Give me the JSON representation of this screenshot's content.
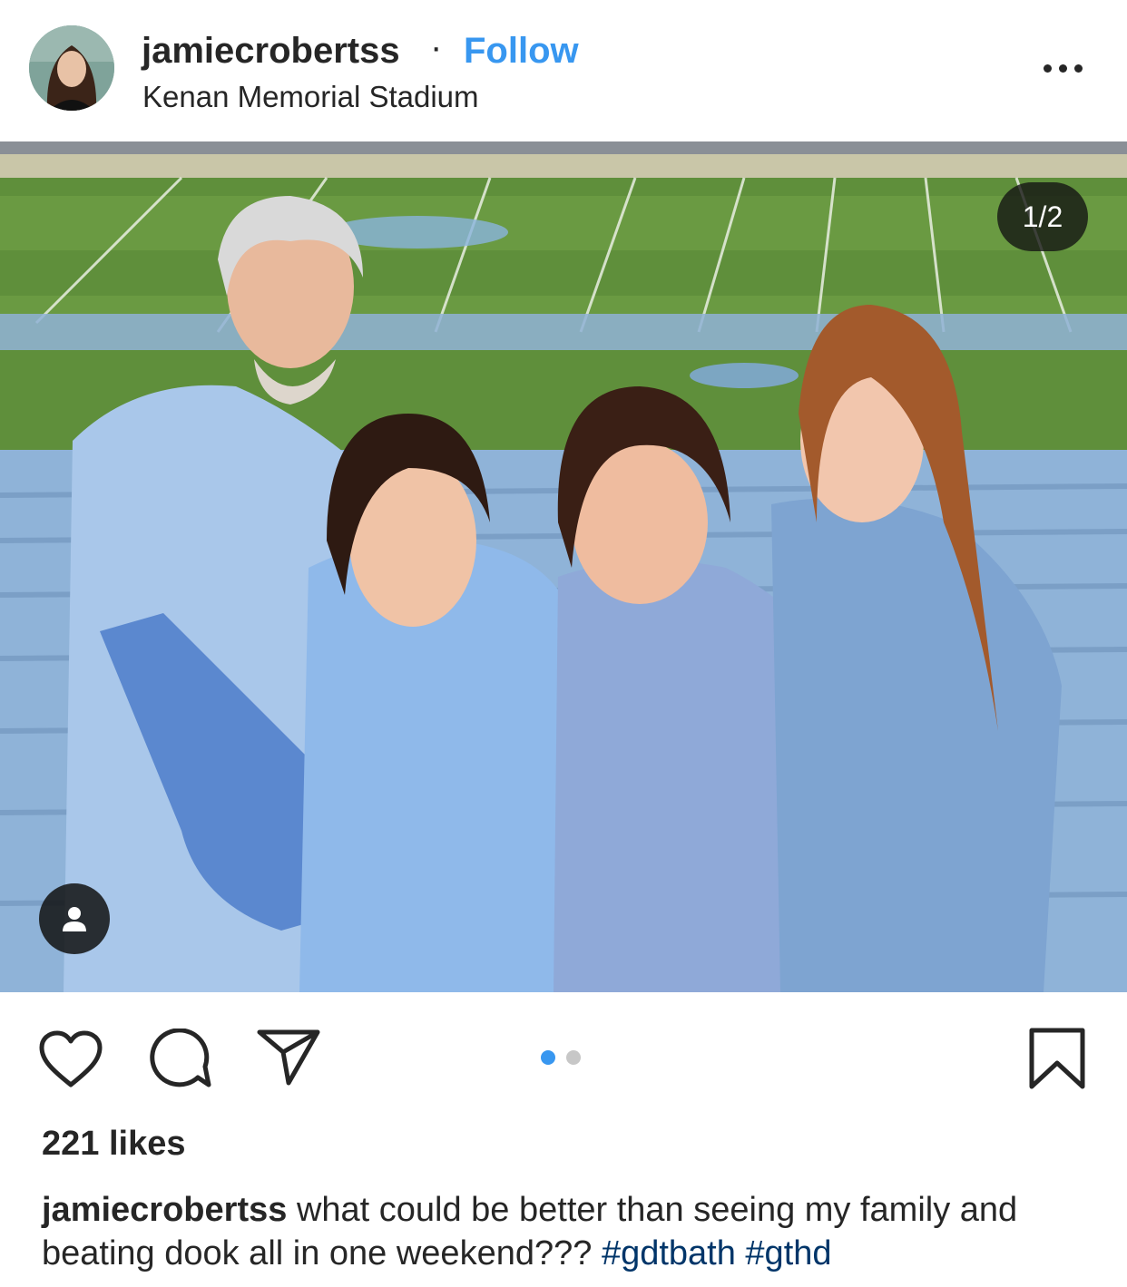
{
  "post": {
    "username": "jamiecrobertss",
    "separator": "·",
    "follow_label": "Follow",
    "location": "Kenan Memorial Stadium"
  },
  "media": {
    "counter": "1/2",
    "total_slides": 2,
    "active_slide": 1
  },
  "actions": {
    "like_icon": "heart-icon",
    "comment_icon": "comment-icon",
    "share_icon": "paper-plane-icon",
    "save_icon": "bookmark-icon",
    "tag_icon": "user-tag-icon"
  },
  "likes": "221 likes",
  "caption": {
    "username": "jamiecrobertss",
    "text": "what could be better than seeing my family and beating dook all in one weekend???",
    "hashtags": [
      "#gdtbath",
      "#gthd"
    ]
  },
  "colors": {
    "link": "#3897f0",
    "hashtag": "#003569",
    "text": "#262626"
  }
}
